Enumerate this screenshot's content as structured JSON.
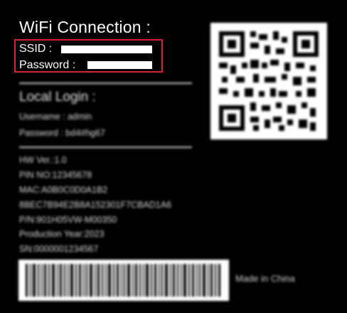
{
  "wifi": {
    "title": "WiFi Connection :",
    "ssid_label": "SSID :",
    "password_label": "Password :"
  },
  "local_login": {
    "title": "Local Login :",
    "username": "Username : admin",
    "password": "Password : bd4#hg67"
  },
  "info_lines": [
    "HW Ver.:1.0",
    "PIN NO:12345678",
    "MAC:A0B0C0D0A1B2",
    "8BEC7B94E2B8A152301F7CBAD1A6",
    "P/N:901H05VW-M00350",
    "Production Year:2023",
    "SN:0000001234567"
  ],
  "made_in": "Made in China",
  "colors": {
    "highlight_border": "#d3232d",
    "background": "#000000",
    "text": "#ffffff"
  }
}
